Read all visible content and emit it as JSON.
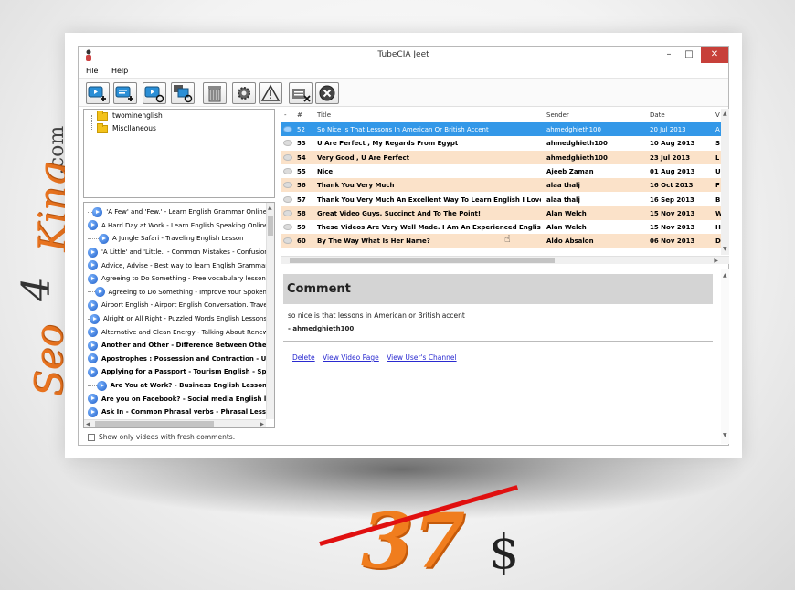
{
  "watermark": {
    "seo": "Seo",
    "four": "4",
    "king": "King",
    "com": ".com"
  },
  "price": {
    "amount": "37",
    "currency": "$"
  },
  "window": {
    "title": "TubeCIA Jeet",
    "minimize": "–",
    "maximize": "□",
    "close": "✕"
  },
  "menu": {
    "file": "File",
    "help": "Help"
  },
  "tree": {
    "items": [
      "twominenglish",
      "Miscllaneous"
    ]
  },
  "videos": [
    {
      "title": "'A Few' and 'Few.' - Learn English Grammar Online",
      "bold": false
    },
    {
      "title": "A Hard Day at Work - Learn English Speaking Online",
      "bold": false
    },
    {
      "title": "A Jungle Safari - Traveling English Lesson",
      "bold": false
    },
    {
      "title": "'A Little' and 'Little.' - Common Mistakes - Confusion",
      "bold": false
    },
    {
      "title": "Advice, Advise - Best way to learn English Grammar",
      "bold": false
    },
    {
      "title": "Agreeing to Do Something - Free vocabulary lessons",
      "bold": false
    },
    {
      "title": "Agreeing to Do Something - Improve Your Spoken",
      "bold": false
    },
    {
      "title": "Airport English - Airport English Conversation. Travel",
      "bold": false
    },
    {
      "title": "Alright or All Right - Puzzled Words English Lessons",
      "bold": false
    },
    {
      "title": "Alternative and Clean Energy - Talking About Renew",
      "bold": false
    },
    {
      "title": "Another and Other - Difference Between Other and",
      "bold": true
    },
    {
      "title": "Apostrophes : Possession and Contraction - Using",
      "bold": true
    },
    {
      "title": "Applying for a Passport - Tourism English - Speak",
      "bold": true
    },
    {
      "title": "Are You at Work? - Business English Lesson",
      "bold": true
    },
    {
      "title": "Are you on Facebook? - Social media English lesson",
      "bold": true
    },
    {
      "title": "Ask In - Common Phrasal verbs - Phrasal Lesson",
      "bold": true
    }
  ],
  "fresh_filter": "Show only videos with fresh comments.",
  "grid": {
    "headers": {
      "dash": "-",
      "num": "#",
      "title": "Title",
      "sender": "Sender",
      "date": "Date",
      "v": "V"
    },
    "rows": [
      {
        "num": "52",
        "title": "So Nice Is That Lessons In American Or British Accent",
        "sender": "ahmedghieth100",
        "date": "20 Jul 2013",
        "v": "A",
        "style": "sel"
      },
      {
        "num": "53",
        "title": "U Are Perfect , My Regards From Egypt",
        "sender": "ahmedghieth100",
        "date": "10 Aug 2013",
        "v": "S",
        "style": ""
      },
      {
        "num": "54",
        "title": "Very Good , U Are Perfect",
        "sender": "ahmedghieth100",
        "date": "23 Jul 2013",
        "v": "L",
        "style": "hl"
      },
      {
        "num": "55",
        "title": "Nice",
        "sender": "Ajeeb Zaman",
        "date": "01 Aug 2013",
        "v": "U",
        "style": ""
      },
      {
        "num": "56",
        "title": "Thank You Very Much",
        "sender": "alaa thalj",
        "date": "16 Oct 2013",
        "v": "F",
        "style": "hl"
      },
      {
        "num": "57",
        "title": "Thank You Very Much An Excellent Way To Learn English I Love You ...",
        "sender": "alaa thalj",
        "date": "16 Sep 2013",
        "v": "B",
        "style": ""
      },
      {
        "num": "58",
        "title": "Great Video Guys, Succinct And To The Point!",
        "sender": "Alan Welch",
        "date": "15 Nov 2013",
        "v": "W",
        "style": "hl"
      },
      {
        "num": "59",
        "title": "These Videos Are Very Well Made.  I Am An Experienced English Te...",
        "sender": "Alan Welch",
        "date": "15 Nov 2013",
        "v": "H",
        "style": ""
      },
      {
        "num": "60",
        "title": "By The Way What Is Her Name?",
        "sender": "Aldo Absalon",
        "date": "06 Nov 2013",
        "v": "D",
        "style": "hl"
      }
    ]
  },
  "comment": {
    "heading": "Comment",
    "text": "so nice is that lessons in American or British accent",
    "author": "- ahmedghieth100",
    "links": {
      "delete": "Delete",
      "view_video": "View Video Page",
      "view_channel": "View User's Channel"
    }
  },
  "toolbar_icons": [
    "add-channel-icon",
    "add-video-icon",
    "refresh-video-icon",
    "refresh-all-icon",
    "trash-icon",
    "gear-icon",
    "warning-icon",
    "clear-list-icon",
    "stop-icon"
  ]
}
